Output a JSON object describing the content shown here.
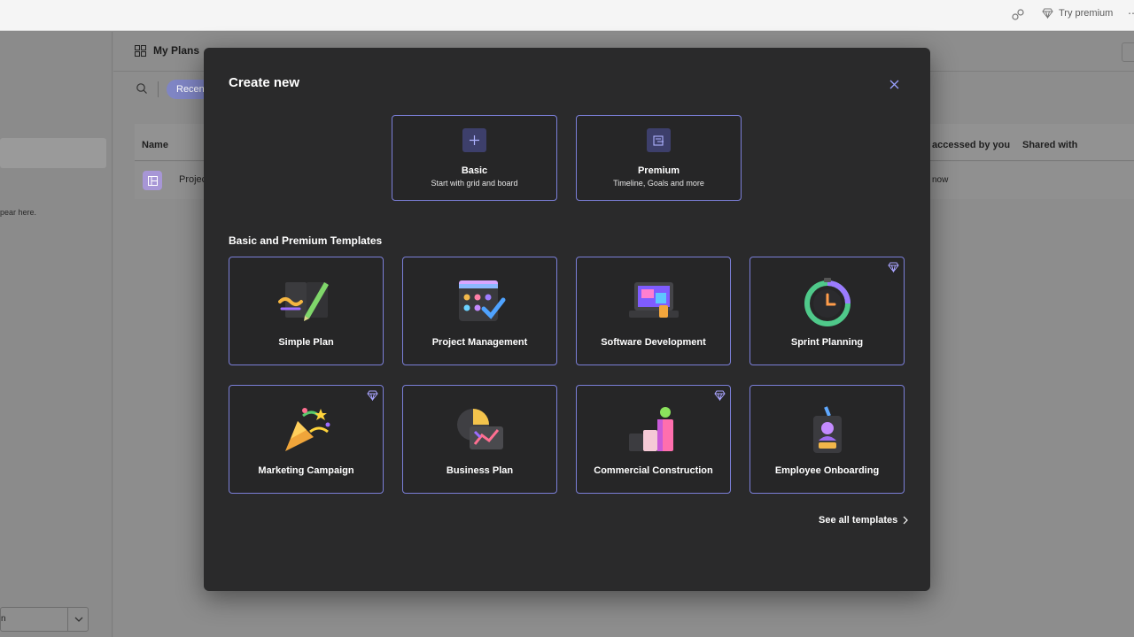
{
  "topbar": {
    "try_premium": "Try premium",
    "icons": [
      "share-icon",
      "diamond-icon",
      "more-icon"
    ]
  },
  "leftnav": {
    "empty_text": "pear here.",
    "bottom_select_value": "n"
  },
  "main": {
    "title": "My Plans",
    "filter_recent": "Recent",
    "columns": {
      "name": "Name",
      "accessed": "accessed by you",
      "shared": "Shared with"
    },
    "row": {
      "name": "Projec",
      "accessed": "now"
    }
  },
  "modal": {
    "title": "Create new",
    "create_options": [
      {
        "title": "Basic",
        "subtitle": "Start with grid and board",
        "icon": "plus-icon"
      },
      {
        "title": "Premium",
        "subtitle": "Timeline, Goals and more",
        "icon": "timeline-icon"
      }
    ],
    "section_title": "Basic and Premium Templates",
    "templates": [
      {
        "label": "Simple Plan",
        "icon": "notebook-pen-icon",
        "premium": false
      },
      {
        "label": "Project Management",
        "icon": "calendar-check-icon",
        "premium": false
      },
      {
        "label": "Software Development",
        "icon": "devices-icon",
        "premium": false
      },
      {
        "label": "Sprint Planning",
        "icon": "timer-icon",
        "premium": true
      },
      {
        "label": "Marketing Campaign",
        "icon": "party-popper-icon",
        "premium": true
      },
      {
        "label": "Business Plan",
        "icon": "chart-globe-icon",
        "premium": false
      },
      {
        "label": "Commercial Construction",
        "icon": "building-blocks-icon",
        "premium": true
      },
      {
        "label": "Employee Onboarding",
        "icon": "badge-icon",
        "premium": false
      }
    ],
    "see_all": "See all templates"
  },
  "colors": {
    "accent": "#7b7fd8",
    "modal_bg": "#2a2a2b",
    "chip": "#7f85c4"
  }
}
